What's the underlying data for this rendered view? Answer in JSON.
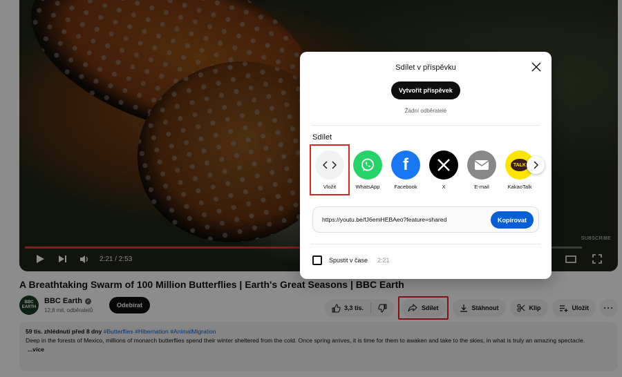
{
  "player": {
    "time": "2:21 / 2:53",
    "progress_fraction": 0.81,
    "watermark": "SUBSCRIBE"
  },
  "video": {
    "title": "A Breathtaking Swarm of 100 Million Butterflies | Earth's Great Seasons | BBC Earth"
  },
  "channel": {
    "avatar_text": "BBC EARTH",
    "name": "BBC Earth",
    "subscribers": "12,8 mil. odběratelů",
    "subscribe_label": "Odebírat"
  },
  "actions": {
    "likes": "3,3 tis.",
    "share": "Sdílet",
    "download": "Stáhnout",
    "clip": "Klip",
    "save": "Uložit"
  },
  "description": {
    "meta": "59 tis. zhlédnutí  před 8 dny",
    "tags": "#Butterflies #Hibernation #AnimalMigration",
    "text": "Deep in the forests of Mexico, millions of monarch butterflies spend their winter sheltered from the cold. Once spring arrives, it is time for them to awaken and take to the skies, in what is truly an amazing spectacle.",
    "more": "...více"
  },
  "dialog": {
    "title": "Sdílet v příspěvku",
    "create_post": "Vytvořit příspěvek",
    "no_subscribers": "Žádní odběratelé",
    "share_section": "Sdílet",
    "targets": [
      {
        "label": "Vložit",
        "icon": "embed-icon",
        "color": "#f2f2f2"
      },
      {
        "label": "WhatsApp",
        "icon": "whatsapp-icon",
        "color": "#25d366"
      },
      {
        "label": "Facebook",
        "icon": "facebook-icon",
        "color": "#1877f2"
      },
      {
        "label": "X",
        "icon": "x-icon",
        "color": "#000000"
      },
      {
        "label": "E-mail",
        "icon": "email-icon",
        "color": "#888888"
      },
      {
        "label": "KakaoTalk",
        "icon": "kakaotalk-icon",
        "color": "#fee500"
      }
    ],
    "url": "https://youtu.be/fJ6emHEBAeo?feature=shared",
    "copy_label": "Kopírovat",
    "start_at_label": "Spustit v čase",
    "start_at_time": "2:21"
  },
  "colors": {
    "accent": "#065fd4",
    "highlight": "#e02424",
    "progress": "#e53935"
  }
}
